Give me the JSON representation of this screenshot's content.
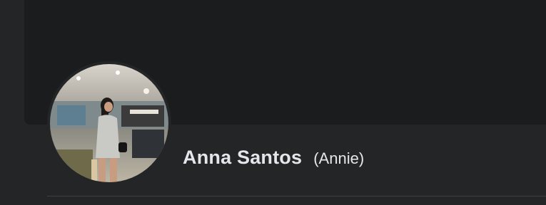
{
  "profile": {
    "name": "Anna Santos",
    "nickname": "(Annie)",
    "avatar_icon": "profile-photo"
  },
  "colors": {
    "page_background": "#242526",
    "cover_background": "#1b1c1e",
    "text_primary": "#e4e6eb",
    "divider": "#3e4042"
  }
}
